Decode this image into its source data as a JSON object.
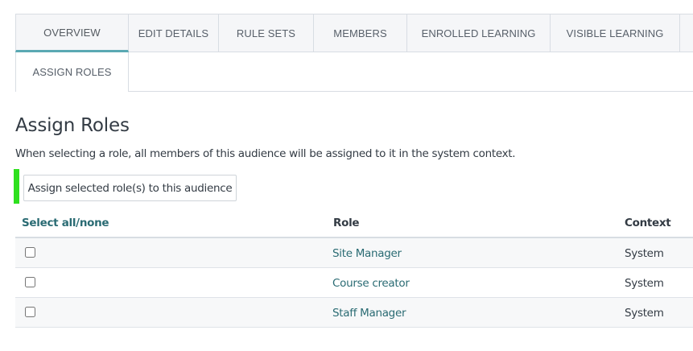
{
  "tabs": {
    "row1": [
      {
        "label": "OVERVIEW",
        "active": true
      },
      {
        "label": "EDIT DETAILS"
      },
      {
        "label": "RULE SETS"
      },
      {
        "label": "MEMBERS"
      },
      {
        "label": "ENROLLED LEARNING"
      },
      {
        "label": "VISIBLE LEARNING"
      }
    ],
    "row2": [
      {
        "label": "ASSIGN ROLES"
      }
    ]
  },
  "page": {
    "title": "Assign Roles",
    "description": "When selecting a role, all members of this audience will be assigned to it in the system context.",
    "assign_button": "Assign selected role(s) to this audience"
  },
  "table": {
    "headers": {
      "select": "Select all/none",
      "role": "Role",
      "context": "Context"
    },
    "rows": [
      {
        "role": "Site Manager",
        "context": "System",
        "checked": false
      },
      {
        "role": "Course creator",
        "context": "System",
        "checked": false
      },
      {
        "role": "Staff Manager",
        "context": "System",
        "checked": false
      }
    ]
  },
  "colors": {
    "accent": "#5aa9b3",
    "link": "#2a6b73",
    "highlight": "#2ee01e"
  }
}
